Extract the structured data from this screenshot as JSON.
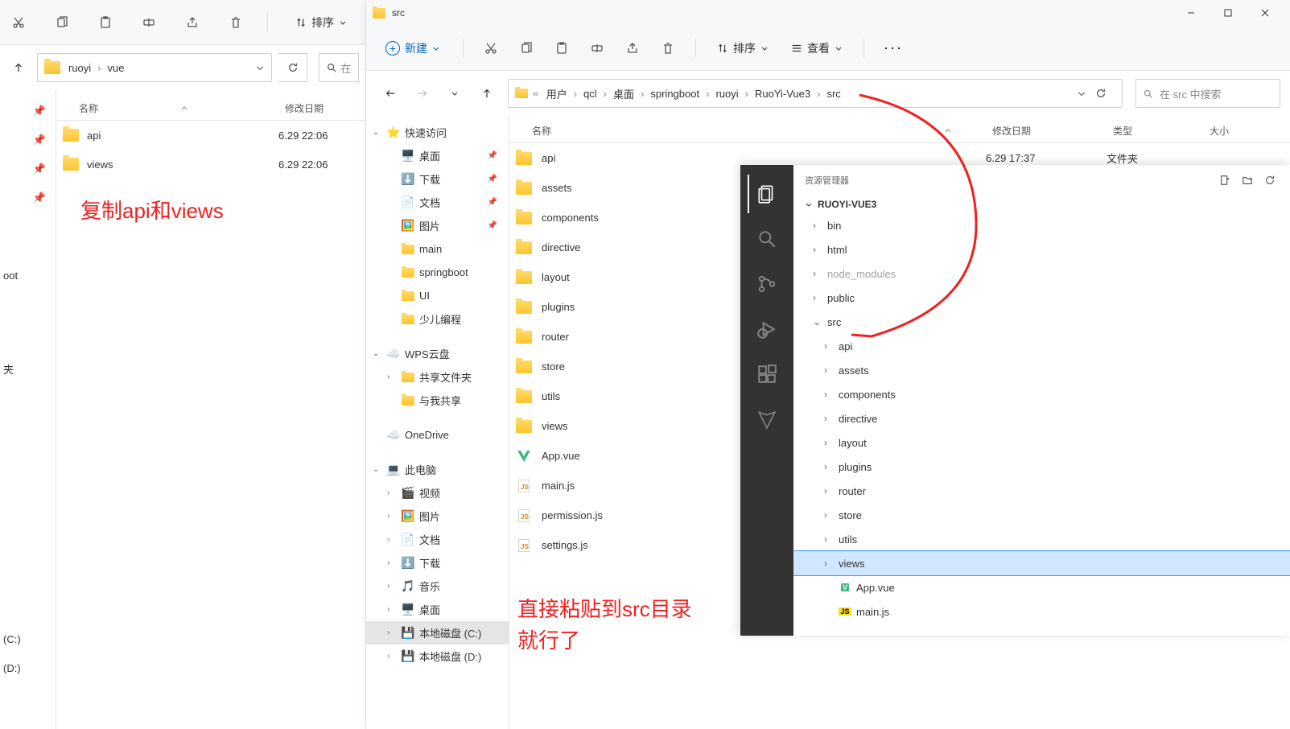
{
  "window1": {
    "toolbar": {
      "sort_label": "排序",
      "icons": [
        "cut-icon",
        "copy-icon",
        "paste-icon",
        "rename-icon",
        "share-icon",
        "delete-icon"
      ]
    },
    "breadcrumbs": [
      "ruoyi",
      "vue"
    ],
    "headers": {
      "name": "名称",
      "date": "修改日期"
    },
    "files": [
      {
        "name": "api",
        "date": "6.29 22:06"
      },
      {
        "name": "views",
        "date": "6.29 22:06"
      }
    ],
    "sidebar_drives": [
      "(C:)",
      "(D:)"
    ],
    "sidebar_bottom": "夹",
    "sidebar_boot": "oot",
    "annotation": "复制api和views"
  },
  "window2": {
    "title": "src",
    "toolbar": {
      "new_label": "新建",
      "sort_label": "排序",
      "view_label": "查看"
    },
    "search_placeholder": "在 src 中搜索",
    "breadcrumbs": [
      "用户",
      "qcl",
      "桌面",
      "springboot",
      "ruoyi",
      "RuoYi-Vue3",
      "src"
    ],
    "headers": {
      "name": "名称",
      "date": "修改日期",
      "type": "类型",
      "size": "大小"
    },
    "tree": [
      {
        "label": "快速访问",
        "icon": "star",
        "expand": true
      },
      {
        "label": "桌面",
        "icon": "desktop",
        "pin": true,
        "indent": 1
      },
      {
        "label": "下载",
        "icon": "download",
        "pin": true,
        "indent": 1
      },
      {
        "label": "文档",
        "icon": "doc",
        "pin": true,
        "indent": 1
      },
      {
        "label": "图片",
        "icon": "image",
        "pin": true,
        "indent": 1
      },
      {
        "label": "main",
        "icon": "folder",
        "indent": 1
      },
      {
        "label": "springboot",
        "icon": "folder",
        "indent": 1
      },
      {
        "label": "UI",
        "icon": "folder",
        "indent": 1
      },
      {
        "label": "少儿编程",
        "icon": "folder",
        "indent": 1
      },
      {
        "label": "WPS云盘",
        "icon": "wps",
        "expand": true
      },
      {
        "label": "共享文件夹",
        "icon": "folder",
        "indent": 1,
        "chev": true
      },
      {
        "label": "与我共享",
        "icon": "folder",
        "indent": 1
      },
      {
        "label": "OneDrive",
        "icon": "onedrive"
      },
      {
        "label": "此电脑",
        "icon": "pc",
        "expand": true
      },
      {
        "label": "视频",
        "icon": "video",
        "indent": 1,
        "chev": true
      },
      {
        "label": "图片",
        "icon": "image",
        "indent": 1,
        "chev": true
      },
      {
        "label": "文档",
        "icon": "doc",
        "indent": 1,
        "chev": true
      },
      {
        "label": "下载",
        "icon": "download",
        "indent": 1,
        "chev": true
      },
      {
        "label": "音乐",
        "icon": "music",
        "indent": 1,
        "chev": true
      },
      {
        "label": "桌面",
        "icon": "desktop",
        "indent": 1,
        "chev": true
      },
      {
        "label": "本地磁盘 (C:)",
        "icon": "disk",
        "indent": 1,
        "chev": true,
        "sel": true
      },
      {
        "label": "本地磁盘 (D:)",
        "icon": "disk",
        "indent": 1,
        "chev": true
      }
    ],
    "files": [
      {
        "name": "api",
        "kind": "folder",
        "date": "6.29 17:37",
        "type": "文件夹"
      },
      {
        "name": "assets",
        "kind": "folder"
      },
      {
        "name": "components",
        "kind": "folder"
      },
      {
        "name": "directive",
        "kind": "folder"
      },
      {
        "name": "layout",
        "kind": "folder"
      },
      {
        "name": "plugins",
        "kind": "folder"
      },
      {
        "name": "router",
        "kind": "folder"
      },
      {
        "name": "store",
        "kind": "folder"
      },
      {
        "name": "utils",
        "kind": "folder"
      },
      {
        "name": "views",
        "kind": "folder"
      },
      {
        "name": "App.vue",
        "kind": "vue"
      },
      {
        "name": "main.js",
        "kind": "js"
      },
      {
        "name": "permission.js",
        "kind": "js"
      },
      {
        "name": "settings.js",
        "kind": "js"
      }
    ],
    "annotation": "直接粘贴到src目录就行了"
  },
  "vscode": {
    "explorer_title": "资源管理器",
    "project": "RUOYI-VUE3",
    "tree": [
      {
        "label": "bin",
        "lvl": 1
      },
      {
        "label": "html",
        "lvl": 1
      },
      {
        "label": "node_modules",
        "lvl": 1,
        "gray": true
      },
      {
        "label": "public",
        "lvl": 1
      },
      {
        "label": "src",
        "lvl": 1,
        "open": true
      },
      {
        "label": "api",
        "lvl": 2
      },
      {
        "label": "assets",
        "lvl": 2
      },
      {
        "label": "components",
        "lvl": 2
      },
      {
        "label": "directive",
        "lvl": 2
      },
      {
        "label": "layout",
        "lvl": 2
      },
      {
        "label": "plugins",
        "lvl": 2
      },
      {
        "label": "router",
        "lvl": 2
      },
      {
        "label": "store",
        "lvl": 2
      },
      {
        "label": "utils",
        "lvl": 2
      },
      {
        "label": "views",
        "lvl": 2,
        "sel": true
      },
      {
        "label": "App.vue",
        "lvl": 2,
        "kind": "vue"
      },
      {
        "label": "main.js",
        "lvl": 2,
        "kind": "js"
      }
    ]
  }
}
